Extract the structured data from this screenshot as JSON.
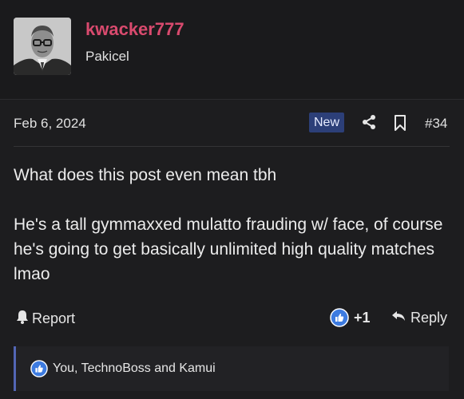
{
  "post": {
    "username": "kwacker777",
    "user_title": "Pakicel",
    "date": "Feb 6, 2024",
    "badge": "New",
    "post_number": "#34",
    "body": {
      "line1": "What does this post even mean tbh",
      "line2": "He's a tall gymmaxxed mulatto frauding w/ face, of course he's going to get basically unlimited high quality matches lmao"
    }
  },
  "actions": {
    "report_label": "Report",
    "like_count": "+1",
    "reply_label": "Reply"
  },
  "reactions": {
    "text": "You, TechnoBoss and Kamui"
  },
  "colors": {
    "username": "#d94a6e",
    "badge_bg": "#2c3f78",
    "like_blue": "#3d7be0",
    "reaction_border": "#5366b5"
  },
  "icons": [
    "share-icon",
    "bookmark-icon",
    "bell-icon",
    "like-icon",
    "reply-icon"
  ]
}
